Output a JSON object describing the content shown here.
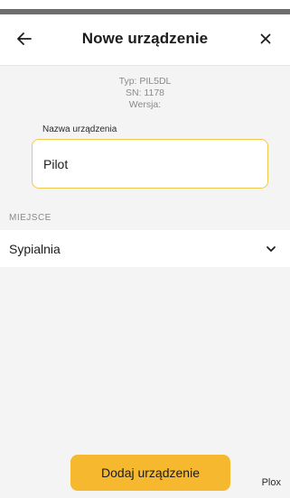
{
  "header": {
    "title": "Nowe urządzenie",
    "back_icon": "arrow-left-icon",
    "close_icon": "close-icon"
  },
  "device_info": {
    "type": "Typ: PIL5DL",
    "serial": "SN: 1178",
    "version": "Wersja:"
  },
  "form": {
    "name_label": "Nazwa urządzenia",
    "name_value": "Pilot",
    "location_section": "MIEJSCE",
    "location_value": "Sypialnia"
  },
  "actions": {
    "add_label": "Dodaj urządzenie"
  },
  "footer": {
    "brand": "Plox"
  },
  "colors": {
    "accent": "#f5b82e",
    "input_border": "#f2c84b",
    "background": "#f4f4f4"
  }
}
